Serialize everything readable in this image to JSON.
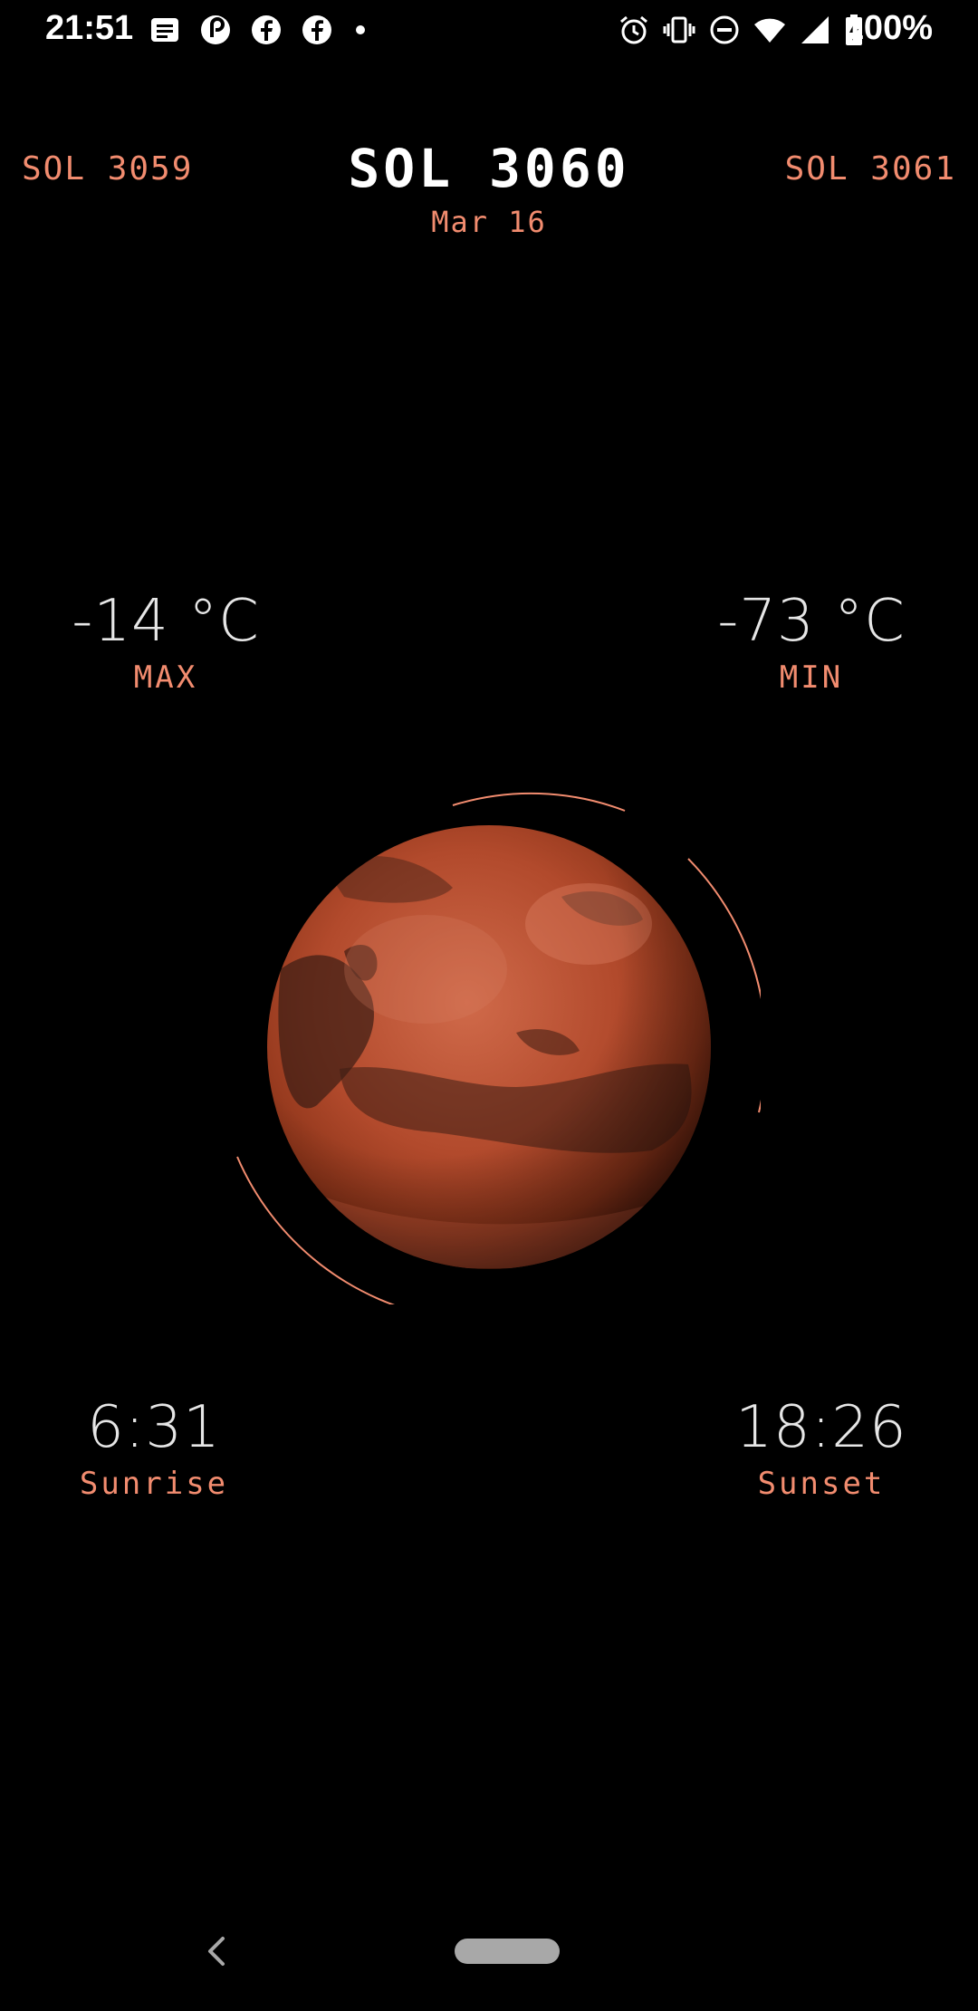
{
  "status_bar": {
    "time": "21:51",
    "battery_text": "100%",
    "left_icons": [
      "messages-icon",
      "pocket-casts-icon",
      "facebook-icon",
      "facebook-icon",
      "more-dot-icon"
    ],
    "right_icons": [
      "alarm-icon",
      "vibrate-icon",
      "do-not-disturb-icon",
      "wifi-icon",
      "cell-signal-icon",
      "battery-charging-icon"
    ]
  },
  "header": {
    "prev_sol": "SOL 3059",
    "current_sol": "SOL 3060",
    "next_sol": "SOL 3061",
    "date": "Mar 16"
  },
  "temperature": {
    "max_value": "-14 °C",
    "max_label": "MAX",
    "min_value": "-73 °C",
    "min_label": "MIN"
  },
  "sun": {
    "sunrise_value": "6:31",
    "sunrise_label": "Sunrise",
    "sunset_value": "18:26",
    "sunset_label": "Sunset"
  },
  "colors": {
    "accent": "#f28c6f",
    "background": "#000000",
    "title": "#ffffff",
    "planet": "#b24a2c"
  },
  "nav_bar": {
    "icons": [
      "back-icon",
      "home-pill"
    ]
  }
}
